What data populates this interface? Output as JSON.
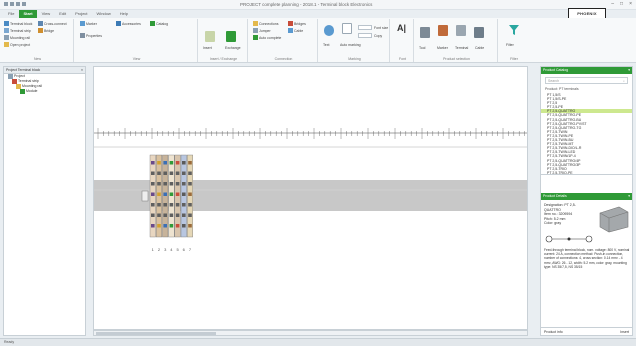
{
  "window": {
    "title": "PROJECT complete planning - 2018.1 - Terminal block Electronics"
  },
  "brand_logo_text": "PHOENIX CONTACT",
  "tabs": [
    "File",
    "Start",
    "View",
    "Edit",
    "Project",
    "Window",
    "Help"
  ],
  "ribbon": {
    "groups": {
      "new": {
        "label": "New",
        "items": [
          "Terminal block",
          "Cross-connect",
          "Terminal strip",
          "Bridge",
          "Mounting rail",
          "Open project"
        ]
      },
      "view": {
        "label": "View",
        "items": [
          "Marker",
          "Accessories",
          "Catalog",
          "Properties"
        ]
      },
      "insert": {
        "label": "Insert / Exchange",
        "items": [
          "Insert",
          "Exchange"
        ]
      },
      "connection": {
        "label": "Connection",
        "items": [
          "Connections",
          "Bridges",
          "Jumper",
          "Cable",
          "Auto complete"
        ]
      },
      "marking": {
        "label": "Marking",
        "items": [
          "Text",
          "Auto marking",
          "Font size",
          "Copy"
        ]
      },
      "font": {
        "label": "Font",
        "items": [
          "A|"
        ]
      },
      "products": {
        "label": "Product selection",
        "items": [
          "Tool",
          "Marker",
          "Terminal",
          "Cable"
        ]
      },
      "filter": {
        "label": "Filter",
        "items": [
          "Filter"
        ]
      }
    }
  },
  "left_panel": {
    "header": "Project  Terminal block",
    "tree": [
      "Project",
      "Terminal strip",
      "Mounting rail",
      "Module"
    ]
  },
  "canvas": {
    "terminal_labels": [
      "1",
      "2",
      "3",
      "4",
      "5",
      "6",
      "7"
    ]
  },
  "right_panel": {
    "product_header": "Product Catalog",
    "search_placeholder": "Search",
    "list_title": "Product: PT terminals",
    "items": [
      "PT 1,5/S",
      "PT 1,5/S-PE",
      "PT 2,5",
      "PT 2,5-PE",
      "PT 2,5-QUATTRO",
      "PT 2,5-QUATTRO-PE",
      "PT 2,5-QUATTRO-BU",
      "PT 2,5-QUATTRO-PV/ST",
      "PT 2,5-QUATTRO-TG",
      "PT 2,5-TWIN",
      "PT 2,5-TWIN-PE",
      "PT 2,5-TWIN-BU",
      "PT 2,5-TWIN-MT",
      "PT 2,5-TWIN-DIO/L-R",
      "PT 2,5-TWIN-LED",
      "PT 2,5-TWIN/1P-4",
      "PT 2,5-QUATTRO/4P",
      "PT 2,5-QUATTRO/3P",
      "PT 2,5-TRIO",
      "PT 2,5-TRIO-PE"
    ],
    "selected_index": 4,
    "detail_header": "Product Details",
    "detail": {
      "name": "Designation: PT 2,5-QUATTRO",
      "line1": "Item no.: 3209594",
      "line2": "Pitch: 5.2 mm",
      "line3": "Color: gray",
      "desc": "Feed-through terminal block, nom. voltage: 800 V, nominal current: 24 A, connection method: Push-in connection, number of connections: 4, cross section: 0.14 mm² - 4 mm², AWG: 26 - 12, width: 5.2 mm, color: gray, mounting type: NS 35/7,5, NS 35/15"
    },
    "footer_left": "Product info",
    "footer_right": "Insert"
  },
  "status_bar": "Ready",
  "colors": {
    "accent": "#2f9a37",
    "selection": "#cde88f"
  }
}
